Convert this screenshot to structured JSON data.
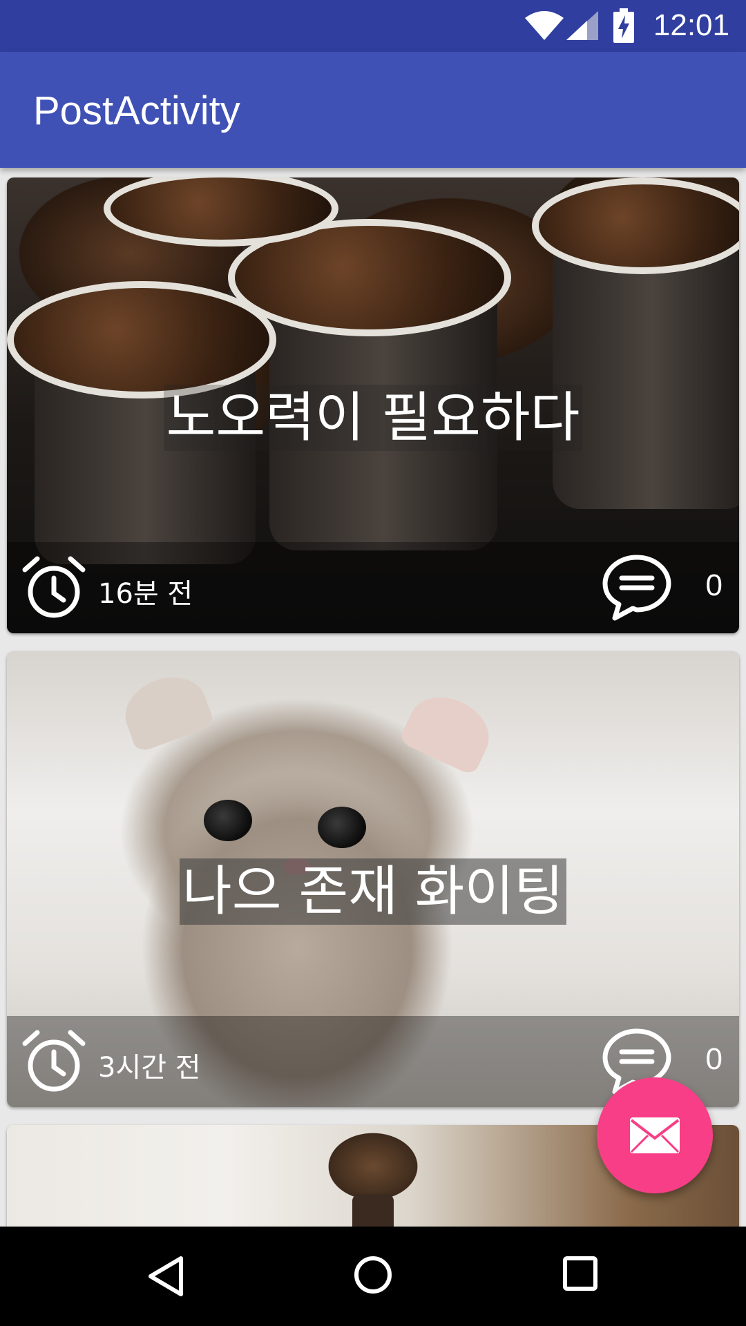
{
  "status_bar": {
    "time": "12:01",
    "icons": [
      "wifi-icon",
      "signal-icon",
      "battery-charging-icon"
    ]
  },
  "app_bar": {
    "title": "PostActivity",
    "color": "#3f51b5",
    "status_color": "#303f9f"
  },
  "posts": [
    {
      "caption": "노오력이 필요하다",
      "time_ago": "16분 전",
      "comment_count": "0",
      "image": "coffee-beans-cups-photo"
    },
    {
      "caption": "나으 존재 화이팅",
      "time_ago": "3시간 전",
      "comment_count": "0",
      "image": "kitten-photo"
    },
    {
      "image": "kitchen-photo"
    }
  ],
  "fab": {
    "icon": "envelope-icon",
    "color": "#f73e86"
  },
  "nav_bar": {
    "icons": [
      "back-icon",
      "home-icon",
      "recents-icon"
    ]
  }
}
